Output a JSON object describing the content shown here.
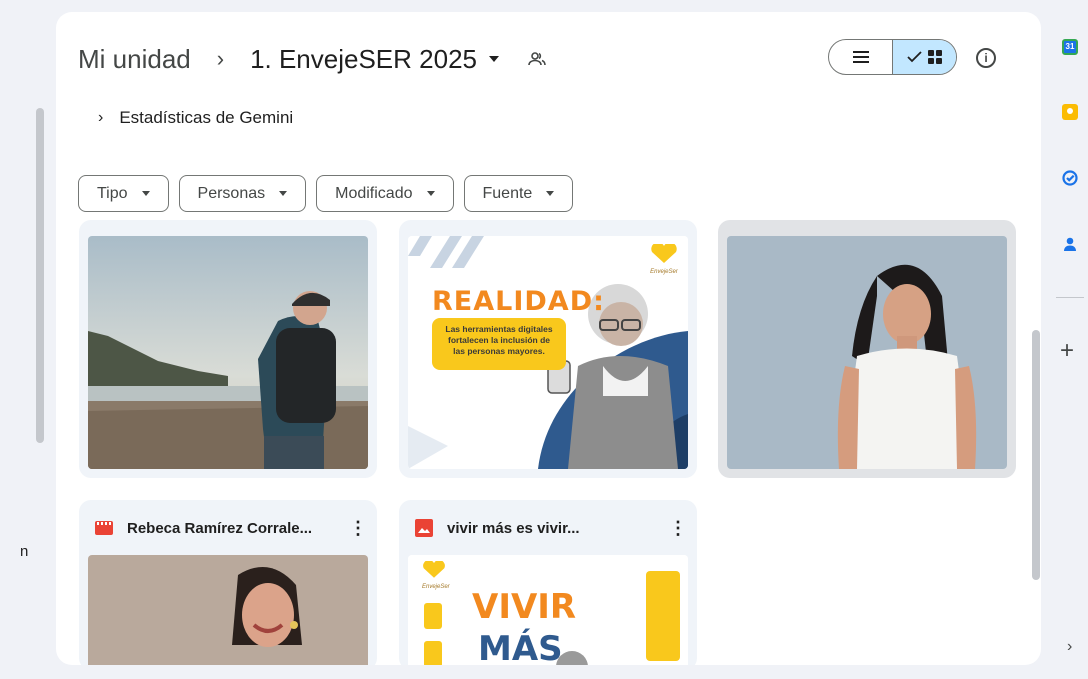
{
  "breadcrumb": {
    "root": "Mi unidad",
    "separator": "›",
    "current": "1. EnvejeSER 2025"
  },
  "gemini": {
    "label": "Estadísticas de Gemini",
    "icon": "chevron-right-icon"
  },
  "filters": [
    {
      "label": "Tipo"
    },
    {
      "label": "Personas"
    },
    {
      "label": "Modificado"
    },
    {
      "label": "Fuente"
    }
  ],
  "view_toggle": {
    "selected": "grid"
  },
  "files": [
    {
      "type": "image",
      "icon": "image-icon"
    },
    {
      "type": "image",
      "icon": "image-icon",
      "poster": {
        "title": "REALIDAD:",
        "body_lines": [
          "Las herramientas digitales",
          "fortalecen la inclusión de",
          "las personas mayores."
        ],
        "brand": "EnvejeSer"
      }
    },
    {
      "type": "video",
      "icon": "video-icon",
      "selected": true
    },
    {
      "type": "video",
      "icon": "video-icon",
      "title": "Rebeca Ramírez Corrale..."
    },
    {
      "type": "image",
      "icon": "image-icon",
      "title": "vivir más es vivir...",
      "poster": {
        "line1": "VIVIR",
        "line2": "MÁS",
        "brand": "EnvejeSer"
      }
    }
  ],
  "left_rail_text": "n",
  "right_rail": {
    "calendar_day": "31",
    "icons": [
      "calendar-icon",
      "keep-icon",
      "tasks-icon",
      "contacts-icon"
    ],
    "add": "+",
    "expand": "›"
  },
  "colors": {
    "accent": "#c2e7ff",
    "card_bg": "#f0f4f9",
    "video_red": "#ea4335",
    "poster_yellow": "#f9c81c",
    "poster_orange": "#f2891f"
  }
}
